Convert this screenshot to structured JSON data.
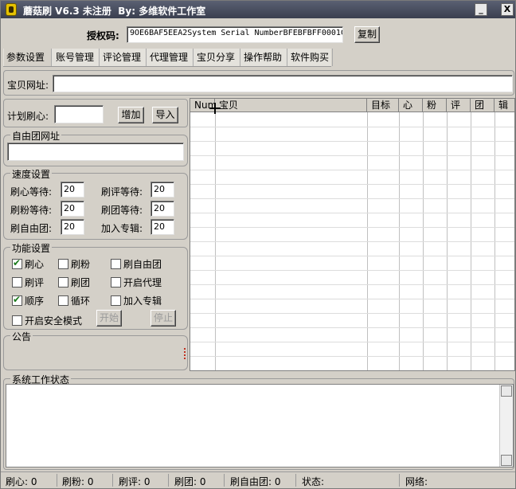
{
  "window": {
    "title": "蘑菇刷 V6.3 未注册  By: 多维软件工作室",
    "minimize": "_",
    "close": "X"
  },
  "license": {
    "label": "授权码:",
    "value": "9OE6BAF5EEA2System Serial NumberBFEBFBFF0001C",
    "copy_button": "复制"
  },
  "tabs": [
    "参数设置",
    "账号管理",
    "评论管理",
    "代理管理",
    "宝贝分享",
    "操作帮助",
    "软件购买"
  ],
  "item_url": {
    "label": "宝贝网址:",
    "value": ""
  },
  "plan": {
    "label": "计划刷心:",
    "value": "",
    "add_button": "增加",
    "import_button": "导入"
  },
  "group_url": {
    "title": "自由团网址",
    "value": ""
  },
  "speed": {
    "title": "速度设置",
    "fields": [
      {
        "label": "刷心等待:",
        "value": "20"
      },
      {
        "label": "刷评等待:",
        "value": "20"
      },
      {
        "label": "刷粉等待:",
        "value": "20"
      },
      {
        "label": "刷团等待:",
        "value": "20"
      },
      {
        "label": "刷自由团:",
        "value": "20"
      },
      {
        "label": "加入专辑:",
        "value": "20"
      }
    ]
  },
  "functions": {
    "title": "功能设置",
    "options": [
      {
        "label": "刷心",
        "checked": true
      },
      {
        "label": "刷粉",
        "checked": false
      },
      {
        "label": "刷自由团",
        "checked": false
      },
      {
        "label": "刷评",
        "checked": false
      },
      {
        "label": "刷团",
        "checked": false
      },
      {
        "label": "开启代理",
        "checked": false
      },
      {
        "label": "顺序",
        "checked": true
      },
      {
        "label": "循环",
        "checked": false
      },
      {
        "label": "加入专辑",
        "checked": false
      },
      {
        "label": "开启安全模式",
        "checked": false
      }
    ],
    "start_button": "开始",
    "stop_button": "停止"
  },
  "notice": {
    "title": "公告"
  },
  "table": {
    "columns": [
      "Num",
      "宝贝",
      "目标",
      "心",
      "粉",
      "评",
      "团",
      "辑"
    ]
  },
  "work_status": {
    "title": "系统工作状态",
    "content": ""
  },
  "statusbar": {
    "items": [
      "刷心: 0",
      "刷粉: 0",
      "刷评: 0",
      "刷团: 0",
      "刷自由团: 0",
      "状态:",
      "网络:"
    ]
  }
}
